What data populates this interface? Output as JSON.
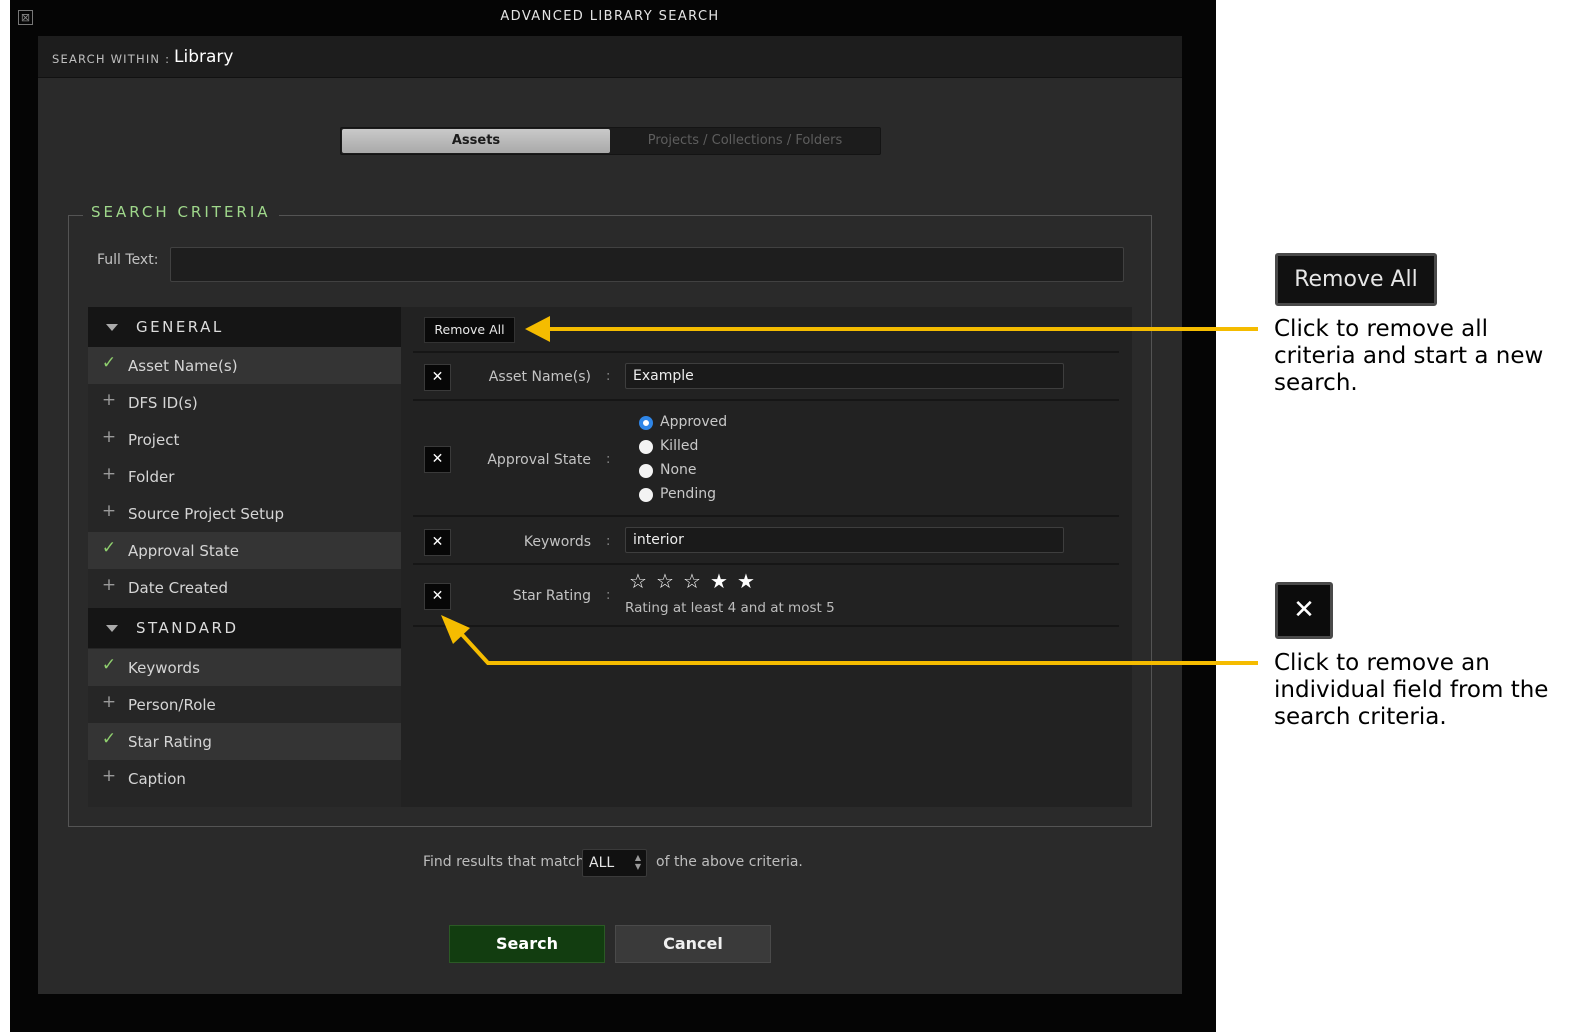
{
  "window": {
    "title": "ADVANCED LIBRARY SEARCH",
    "close_glyph": "⊠"
  },
  "search_within": {
    "label": "SEARCH WITHIN :",
    "value": "Library"
  },
  "tabs": [
    {
      "label": "Assets",
      "active": true
    },
    {
      "label": "Projects / Collections / Folders",
      "active": false
    }
  ],
  "criteria": {
    "legend": "SEARCH CRITERIA",
    "full_text": {
      "label": "Full Text:",
      "value": ""
    }
  },
  "categories": [
    {
      "label": "GENERAL",
      "items": [
        {
          "label": "Asset Name(s)",
          "selected": true
        },
        {
          "label": "DFS ID(s)",
          "selected": false
        },
        {
          "label": "Project",
          "selected": false
        },
        {
          "label": "Folder",
          "selected": false
        },
        {
          "label": "Source Project Setup",
          "selected": false
        },
        {
          "label": "Approval State",
          "selected": true
        },
        {
          "label": "Date Created",
          "selected": false
        }
      ]
    },
    {
      "label": "STANDARD",
      "items": [
        {
          "label": "Keywords",
          "selected": true
        },
        {
          "label": "Person/Role",
          "selected": false
        },
        {
          "label": "Star Rating",
          "selected": true
        },
        {
          "label": "Caption",
          "selected": false
        }
      ]
    }
  ],
  "panel": {
    "remove_all_label": "Remove All",
    "remove_glyph": "✕",
    "colon": ":",
    "fields": {
      "asset_names": {
        "label": "Asset Name(s)",
        "value": "Example"
      },
      "approval_state": {
        "label": "Approval State",
        "options": [
          "Approved",
          "Killed",
          "None",
          "Pending"
        ],
        "selected": "Approved"
      },
      "keywords": {
        "label": "Keywords",
        "value": "interior"
      },
      "star_rating": {
        "label": "Star Rating",
        "min": 4,
        "max": 5,
        "summary": "Rating at least 4 and at most 5"
      }
    }
  },
  "footer": {
    "prefix": "Find results that match",
    "match_value": "ALL",
    "suffix": "of the above criteria.",
    "search_label": "Search",
    "cancel_label": "Cancel"
  },
  "callouts": {
    "remove_all": {
      "button_label": "Remove All",
      "text": "Click to remove all criteria and start a new search."
    },
    "remove_field": {
      "button_glyph": "✕",
      "text": "Click to remove an individual field from the search criteria."
    }
  },
  "colors": {
    "accent_green": "#9fd88b",
    "arrow": "#f5bc00",
    "radio_selected": "#2f86e8",
    "search_button": "#123d10"
  }
}
